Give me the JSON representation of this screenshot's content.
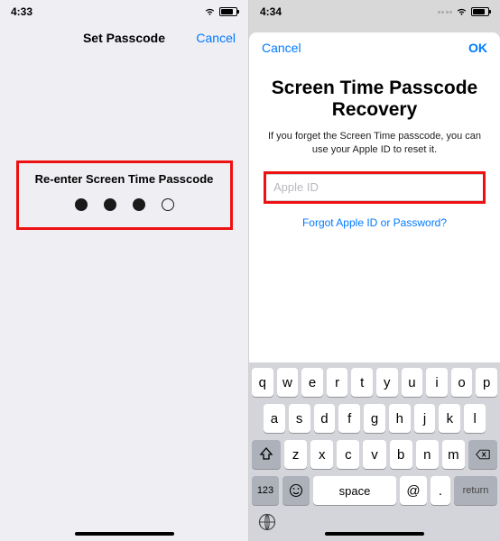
{
  "left": {
    "time": "4:33",
    "nav_title": "Set Passcode",
    "cancel": "Cancel",
    "prompt": "Re-enter Screen Time Passcode",
    "pin_filled": [
      true,
      true,
      true,
      false
    ]
  },
  "right": {
    "time": "4:34",
    "cancel": "Cancel",
    "ok": "OK",
    "title": "Screen Time Passcode Recovery",
    "subtitle": "If you forget the Screen Time passcode, you can use your Apple ID to reset it.",
    "placeholder": "Apple ID",
    "forgot": "Forgot Apple ID or Password?",
    "keyboard": {
      "row1": [
        "q",
        "w",
        "e",
        "r",
        "t",
        "y",
        "u",
        "i",
        "o",
        "p"
      ],
      "row2": [
        "a",
        "s",
        "d",
        "f",
        "g",
        "h",
        "j",
        "k",
        "l"
      ],
      "row3": [
        "z",
        "x",
        "c",
        "v",
        "b",
        "n",
        "m"
      ],
      "num_key": "123",
      "space": "space",
      "at": "@",
      "dot": ".",
      "return": "return"
    }
  }
}
